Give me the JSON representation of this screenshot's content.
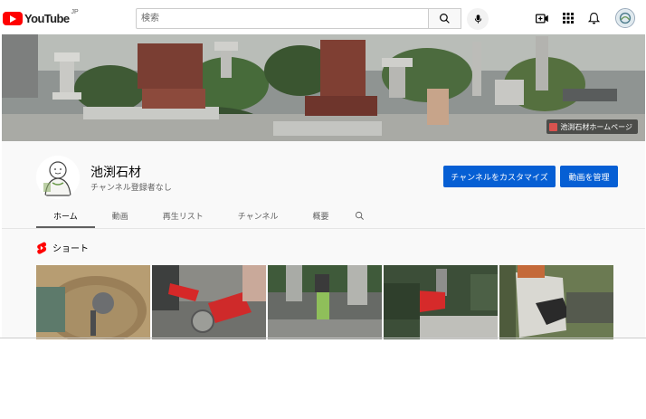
{
  "header": {
    "logo_text": "YouTube",
    "logo_region": "JP",
    "search_placeholder": "検索",
    "icons": [
      "search-icon",
      "microphone-icon",
      "create-video-icon",
      "apps-grid-icon",
      "notifications-bell-icon",
      "account-avatar"
    ]
  },
  "banner": {
    "link_label": "池渕石材ホームページ"
  },
  "channel": {
    "name": "池渕石材",
    "subscribers": "チャンネル登録者なし",
    "customize_label": "チャンネルをカスタマイズ",
    "manage_label": "動画を管理"
  },
  "tabs": [
    {
      "label": "ホーム",
      "active": true
    },
    {
      "label": "動画",
      "active": false
    },
    {
      "label": "再生リスト",
      "active": false
    },
    {
      "label": "チャンネル",
      "active": false
    },
    {
      "label": "概要",
      "active": false
    }
  ],
  "shorts": {
    "heading": "ショート",
    "thumbnails": [
      "mixing-cement-thumbnail",
      "gloved-hands-tool-thumbnail",
      "stone-tamper-thumbnail",
      "hammer-chisel-thumbnail",
      "gloved-hands-stone-thumbnail"
    ]
  },
  "colors": {
    "primary_button": "#065fd4",
    "youtube_red": "#ff0000",
    "header_background": "#f9f9f9"
  }
}
